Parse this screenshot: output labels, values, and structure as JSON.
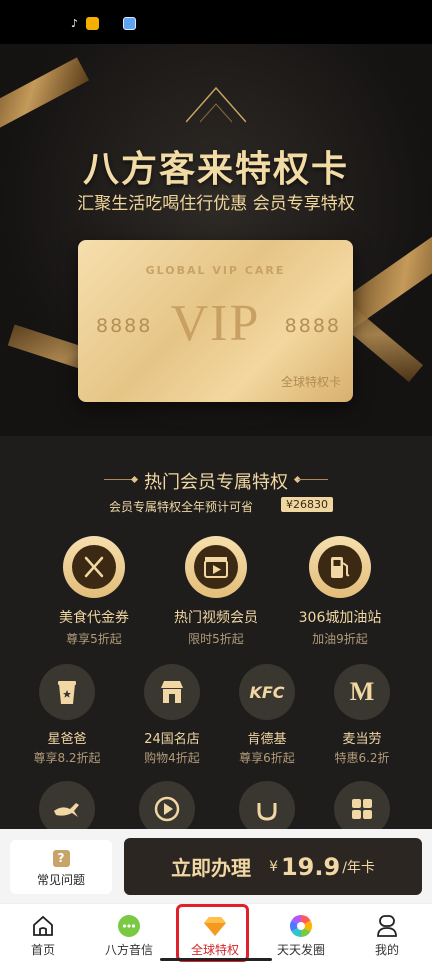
{
  "status_bar": {
    "icons": [
      "tiktok-icon",
      "weibo-icon",
      "app-icon"
    ]
  },
  "hero": {
    "title": "八方客来特权卡",
    "subtitle": "汇聚生活吃喝住行优惠 会员专享特权",
    "card": {
      "top_text": "GLOBAL VIP CARE",
      "number_left": "8888",
      "vip": "VIP",
      "number_right": "8888",
      "label": "全球特权卡"
    }
  },
  "benefits": {
    "title": "热门会员专属特权",
    "note": "会员专属特权全年预计可省",
    "savings": "¥26830",
    "featured": [
      {
        "name": "美食代金券",
        "desc": "尊享5折起",
        "icon": "cutlery-icon"
      },
      {
        "name": "热门视频会员",
        "desc": "限时5折起",
        "icon": "video-icon"
      },
      {
        "name": "306城加油站",
        "desc": "加油9折起",
        "icon": "gas-pump-icon"
      }
    ],
    "brands": [
      {
        "name": "星爸爸",
        "desc": "尊享8.2折起",
        "icon": "coffee-cup-icon"
      },
      {
        "name": "24国名店",
        "desc": "购物4折起",
        "icon": "store-icon"
      },
      {
        "name": "肯德基",
        "desc": "尊享6折起",
        "icon": "kfc-logo",
        "logo_text": "KFC"
      },
      {
        "name": "麦当劳",
        "desc": "特惠6.2折",
        "icon": "mcdonalds-logo",
        "logo_text": "M"
      }
    ],
    "more_icons": [
      "kangaroo-icon",
      "play-icon",
      "didi-icon",
      "grid-icon"
    ]
  },
  "purchase": {
    "faq_label": "常见问题",
    "button_label": "立即办理",
    "currency": "¥",
    "price": "19.9",
    "unit": "/年卡"
  },
  "tabs": [
    {
      "label": "首页",
      "icon": "home-icon"
    },
    {
      "label": "八方音信",
      "icon": "chat-icon"
    },
    {
      "label": "全球特权",
      "icon": "diamond-icon",
      "active": true
    },
    {
      "label": "天天发圈",
      "icon": "aperture-icon"
    },
    {
      "label": "我的",
      "icon": "profile-icon"
    }
  ],
  "colors": {
    "gold": "#e9c98e",
    "dark": "#1b1b1b",
    "active_tab": "#d4262b"
  }
}
